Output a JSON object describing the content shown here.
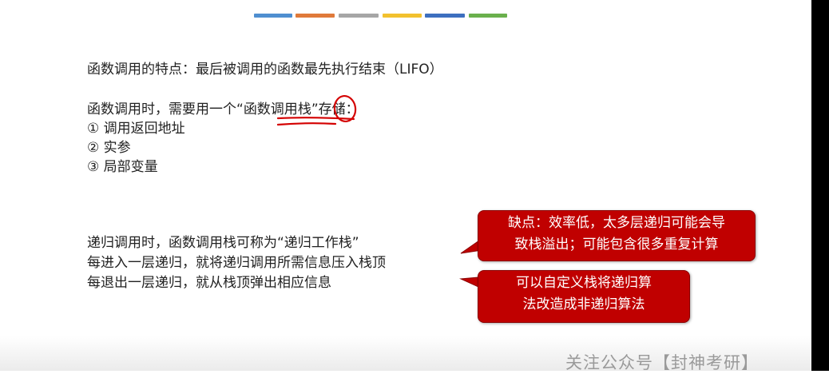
{
  "accent_colors": [
    "#4f8fd0",
    "#e07a3a",
    "#a6a6a6",
    "#f2c12e",
    "#3d6fbf",
    "#6ab04c"
  ],
  "section1": {
    "feature_line": "函数调用的特点：最后被调用的函数最先执行结束（LIFO）"
  },
  "section2": {
    "storage_line_prefix": "函数调用时，需要用一个“",
    "storage_term_underlined": "函数调用",
    "storage_term_circled": "栈",
    "storage_line_suffix": "”存储：",
    "items": [
      "① 调用返回地址",
      "② 实参",
      "③ 局部变量"
    ]
  },
  "section3": {
    "lines": [
      "递归调用时，函数调用栈可称为“递归工作栈”",
      "每进入一层递归，就将递归调用所需信息压入栈顶",
      "每退出一层递归，就从栈顶弹出相应信息"
    ]
  },
  "callouts": {
    "drawback": [
      "缺点：效率低，太多层递归可能会导",
      "致栈溢出；可能包含很多重复计算"
    ],
    "alternative": [
      "可以自定义栈将递归算",
      "法改造成非递归算法"
    ],
    "color": "#c00000"
  },
  "watermark": "关注公众号【封神考研】"
}
